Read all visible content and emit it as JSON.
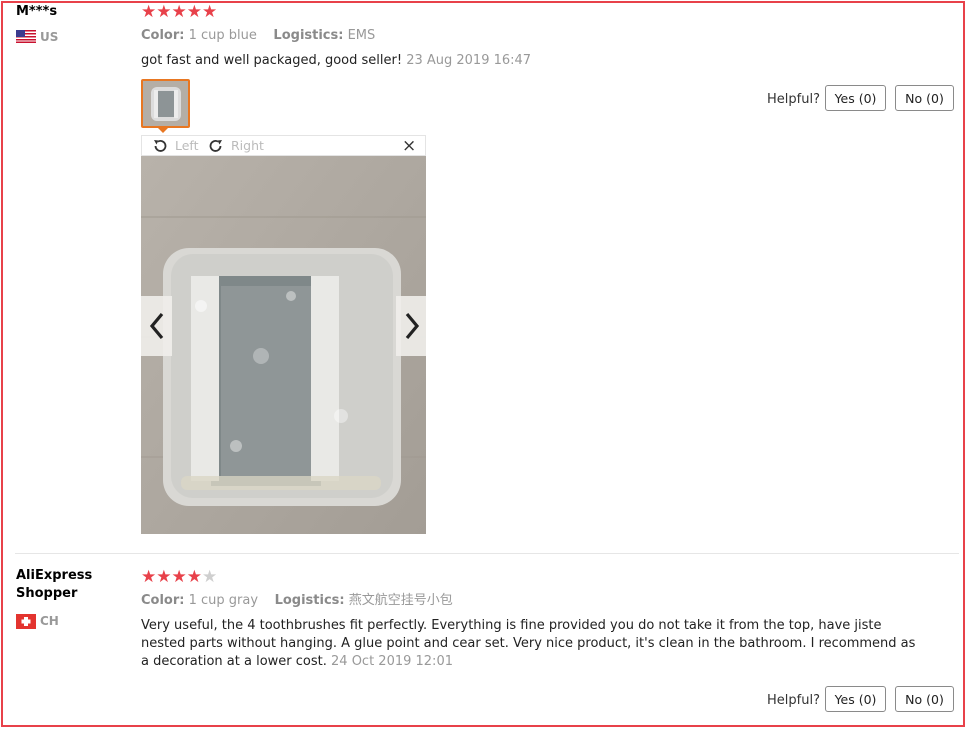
{
  "reviews": [
    {
      "user": "M***s",
      "country": "US",
      "rating": 5,
      "color_label": "Color:",
      "color_value": "1 cup blue",
      "logistics_label": "Logistics:",
      "logistics_value": "EMS",
      "text": "got fast and well packaged, good seller!",
      "date": "23 Aug 2019 16:47",
      "helpful_label": "Helpful?",
      "yes_label": "Yes (0)",
      "no_label": "No (0)"
    },
    {
      "user_line1": "AliExpress",
      "user_line2": "Shopper",
      "country": "CH",
      "rating": 4,
      "color_label": "Color:",
      "color_value": "1 cup gray",
      "logistics_label": "Logistics:",
      "logistics_value": "燕文航空挂号小包",
      "text_line1": "Very useful, the 4 toothbrushes fit perfectly. Everything is fine provided you do not take it from the top, have jiste",
      "text_line2": "nested parts without hanging. A glue point and cear set. Very nice product, it's clean in the bathroom. I recommend as",
      "text_line3": "a decoration at a lower cost.",
      "date": "24 Oct 2019 12:01",
      "helpful_label": "Helpful?",
      "yes_label": "Yes (0)",
      "no_label": "No (0)"
    }
  ],
  "viewer": {
    "rotate_left_label": "Left",
    "rotate_right_label": "Right",
    "close_glyph": "×"
  },
  "colors": {
    "accent_red": "#e8414a",
    "thumb_border": "#e87722"
  }
}
